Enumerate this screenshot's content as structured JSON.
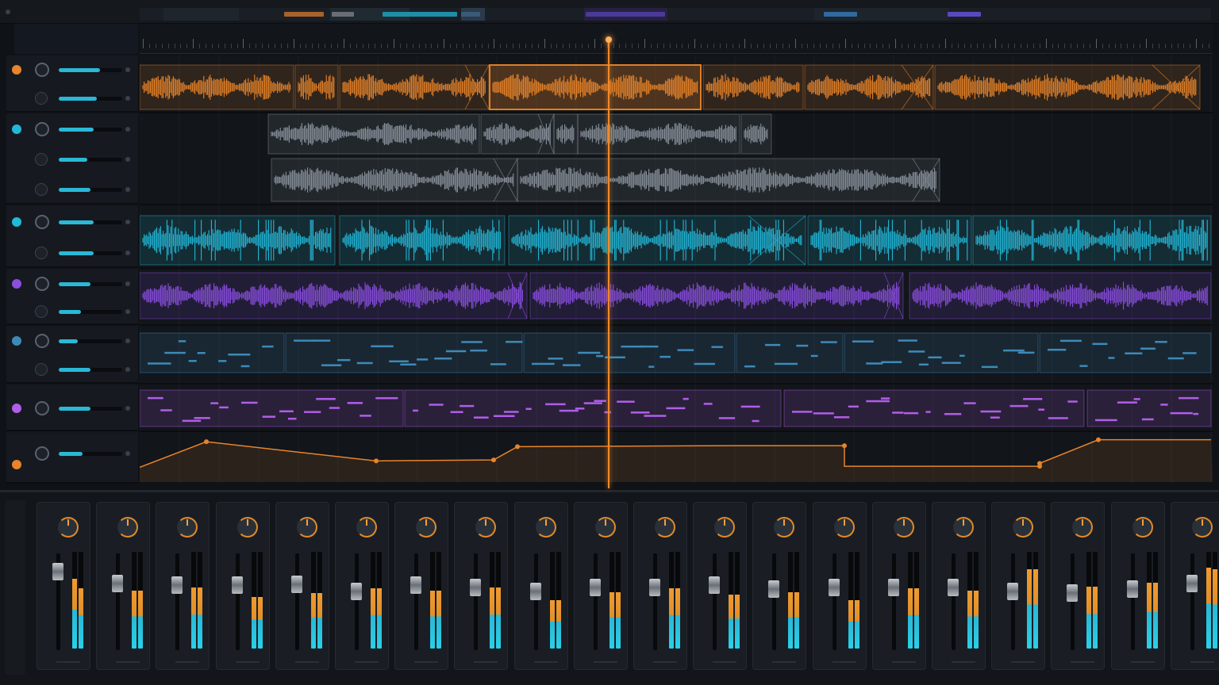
{
  "colors": {
    "orange": "#e8842a",
    "cyan": "#22b8d8",
    "gray": "#8a929c",
    "purple": "#8a4ee0",
    "steel": "#3d8ab8",
    "magenta": "#b05ee8",
    "playhead": "#f08a2a"
  },
  "playhead": {
    "position": 0.437
  },
  "tracks": [
    {
      "color": "orange",
      "lanes": 2,
      "fader_levels": [
        0.65,
        0.6
      ],
      "clip_kind": "audio"
    },
    {
      "color": "cyan",
      "lanes": 3,
      "fader_levels": [
        0.55,
        0.45,
        0.5
      ],
      "clip_kind": "audio"
    },
    {
      "color": "cyan",
      "lanes": 2,
      "fader_levels": [
        0.55,
        0.55
      ],
      "clip_kind": "audio"
    },
    {
      "color": "purple",
      "lanes": 2,
      "fader_levels": [
        0.5,
        0.35
      ],
      "clip_kind": "audio"
    },
    {
      "color": "steel",
      "lanes": 2,
      "fader_levels": [
        0.3,
        0.5
      ],
      "clip_kind": "midi"
    },
    {
      "color": "magenta",
      "lanes": 1,
      "fader_levels": [
        0.5
      ],
      "clip_kind": "midi"
    },
    {
      "color": "orange",
      "lanes": 1,
      "fader_levels": [
        0.38
      ],
      "clip_kind": "automation"
    }
  ],
  "automation": {
    "values": [
      0.3,
      0.82,
      0.43,
      0.45,
      0.72,
      0.74,
      0.74,
      0.32,
      0.32,
      0.38,
      0.86,
      0.86
    ]
  },
  "mixer": {
    "channels": [
      {
        "fader": 0.9,
        "meter_l": 0.72,
        "meter_r": 0.62
      },
      {
        "fader": 0.78,
        "meter_l": 0.6,
        "meter_r": 0.6
      },
      {
        "fader": 0.76,
        "meter_l": 0.63,
        "meter_r": 0.63
      },
      {
        "fader": 0.76,
        "meter_l": 0.53,
        "meter_r": 0.53
      },
      {
        "fader": 0.77,
        "meter_l": 0.57,
        "meter_r": 0.57
      },
      {
        "fader": 0.7,
        "meter_l": 0.62,
        "meter_r": 0.62
      },
      {
        "fader": 0.76,
        "meter_l": 0.6,
        "meter_r": 0.6
      },
      {
        "fader": 0.74,
        "meter_l": 0.63,
        "meter_r": 0.63
      },
      {
        "fader": 0.7,
        "meter_l": 0.5,
        "meter_r": 0.5
      },
      {
        "fader": 0.74,
        "meter_l": 0.58,
        "meter_r": 0.58
      },
      {
        "fader": 0.74,
        "meter_l": 0.62,
        "meter_r": 0.62
      },
      {
        "fader": 0.76,
        "meter_l": 0.56,
        "meter_r": 0.56
      },
      {
        "fader": 0.72,
        "meter_l": 0.58,
        "meter_r": 0.58
      },
      {
        "fader": 0.74,
        "meter_l": 0.5,
        "meter_r": 0.5
      },
      {
        "fader": 0.74,
        "meter_l": 0.62,
        "meter_r": 0.62
      },
      {
        "fader": 0.74,
        "meter_l": 0.6,
        "meter_r": 0.6
      },
      {
        "fader": 0.7,
        "meter_l": 0.82,
        "meter_r": 0.82
      },
      {
        "fader": 0.68,
        "meter_l": 0.64,
        "meter_r": 0.64
      },
      {
        "fader": 0.72,
        "meter_l": 0.68,
        "meter_r": 0.68
      },
      {
        "fader": 0.78,
        "meter_l": 0.84,
        "meter_r": 0.82
      }
    ]
  }
}
